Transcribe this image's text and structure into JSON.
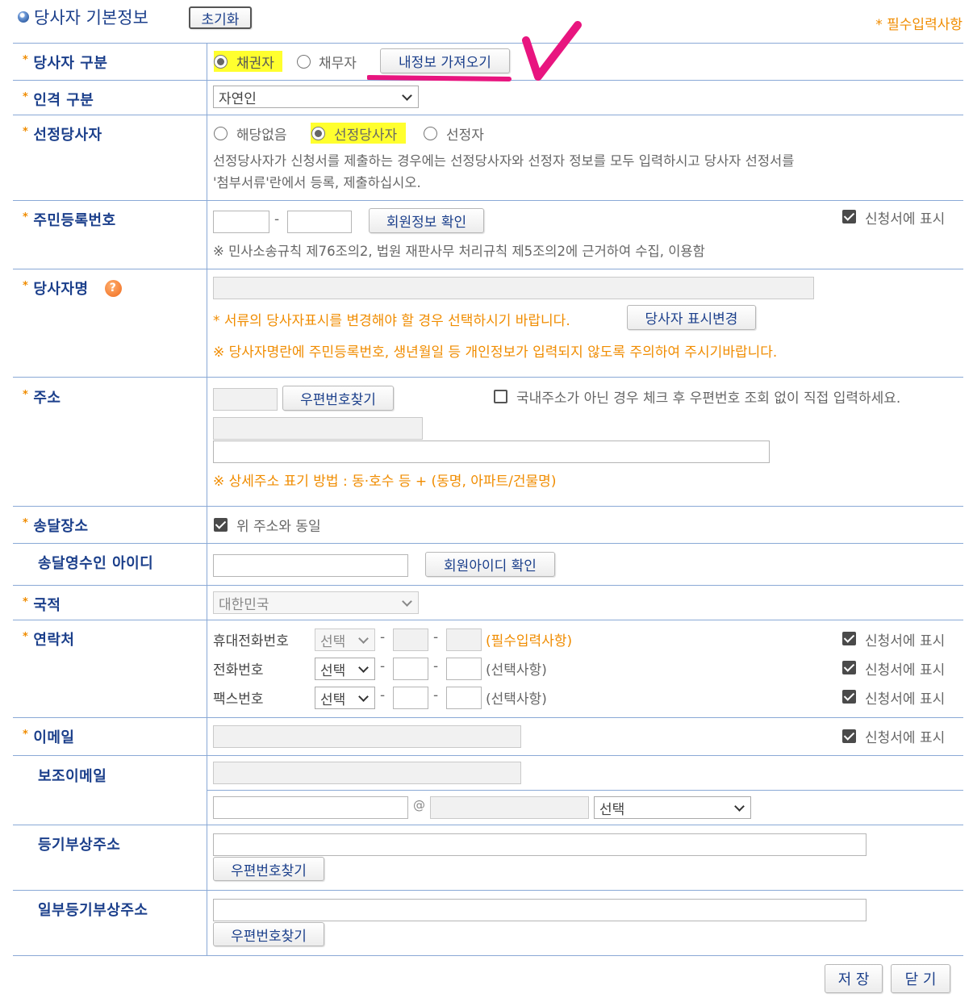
{
  "header": {
    "title": "당사자 기본정보",
    "reset_button": "초기화",
    "required_note": "* 필수입력사항"
  },
  "party_type": {
    "label": "당사자 구분",
    "option_creditor": "채권자",
    "option_debtor": "채무자",
    "selected": "채권자",
    "load_my_info_button": "내정보 가져오기"
  },
  "person_type": {
    "label": "인격 구분",
    "selected": "자연인"
  },
  "appointed_party": {
    "label": "선정당사자",
    "option_none": "해당없음",
    "option_appointed_party": "선정당사자",
    "option_appointer": "선정자",
    "selected": "선정당사자",
    "note_line1": "선정당사자가 신청서를 제출하는 경우에는 선정당사자와 선정자 정보를 모두 입력하시고 당사자 선정서를",
    "note_line2": "'첨부서류'란에서 등록, 제출하십시오."
  },
  "resident_number": {
    "label": "주민등록번호",
    "separator": "-",
    "verify_button": "회원정보 확인",
    "display_on_form": "신청서에 표시",
    "legal_note": "※ 민사소송규칙 제76조의2, 법원 재판사무 처리규칙 제5조의2에 근거하여 수집, 이용함"
  },
  "party_name": {
    "label": "당사자명",
    "help_icon": "?",
    "change_note": "* 서류의 당사자표시를 변경해야 할 경우 선택하시기 바랍니다.",
    "change_button": "당사자 표시변경",
    "privacy_note": "※ 당사자명란에 주민등록번호, 생년월일 등 개인정보가 입력되지 않도록 주의하여 주시기바랍니다."
  },
  "address": {
    "label": "주소",
    "zip_button": "우편번호찾기",
    "foreign_note": "국내주소가 아닌 경우 체크 후 우편번호 조회 없이 직접 입력하세요.",
    "detail_note": "※ 상세주소 표기 방법 : 동·호수 등 + (동명, 아파트/건물명)"
  },
  "delivery_place": {
    "label": "송달장소",
    "same_as_address": "위 주소와 동일"
  },
  "delivery_receiver": {
    "label": "송달영수인 아이디",
    "verify_button": "회원아이디 확인"
  },
  "nationality": {
    "label": "국적",
    "selected": "대한민국"
  },
  "contact": {
    "label": "연락처",
    "mobile_label": "휴대전화번호",
    "phone_label": "전화번호",
    "fax_label": "팩스번호",
    "select_placeholder": "선택",
    "separator": "-",
    "mobile_note": "(필수입력사항)",
    "optional_note": "(선택사항)",
    "display_on_form": "신청서에 표시"
  },
  "email": {
    "label": "이메일",
    "display_on_form": "신청서에 표시"
  },
  "sub_email": {
    "label": "보조이메일",
    "at": "@",
    "domain_select": "선택"
  },
  "registry_address": {
    "label": "등기부상주소",
    "zip_button": "우편번호찾기"
  },
  "partial_registry_address": {
    "label": "일부등기부상주소",
    "zip_button": "우편번호찾기"
  },
  "footer": {
    "save_button": "저 장",
    "close_button": "닫 기"
  },
  "colors": {
    "label_blue": "#1b3f8b",
    "line_blue": "#8aa9d6",
    "required_orange": "#f08c00",
    "highlight_yellow": "#ffff2e",
    "annotation_magenta": "#e8157f"
  }
}
